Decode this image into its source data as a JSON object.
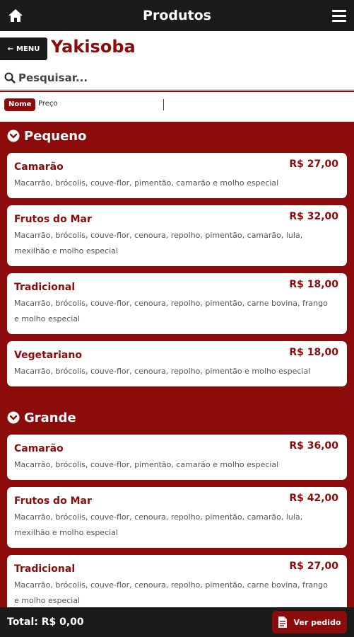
{
  "topbar": {
    "title": "Produtos",
    "home_icon": "home-icon",
    "menu_icon": "hamburger-menu-icon"
  },
  "header": {
    "menu_label": "MENU",
    "title": "Yakisoba"
  },
  "search": {
    "placeholder": "Pesquisar..."
  },
  "filters": {
    "active": "Nome",
    "other": "Preço"
  },
  "sections": [
    {
      "title": "Pequeno",
      "items": [
        {
          "name": "Camarão",
          "price": "R$ 27,00",
          "desc": "Macarrão, brócolis, couve-flor, pimentão, camarão e molho especial"
        },
        {
          "name": "Frutos do Mar",
          "price": "R$ 32,00",
          "desc": "Macarrão, brócolis, couve-flor, cenoura, repolho, pimentão, camarão, lula, mexilhão e molho especial"
        },
        {
          "name": "Tradicional",
          "price": "R$ 18,00",
          "desc": "Macarrão, brócolis, couve-flor, cenoura, repolho, pimentão, carne bovina, frango e molho especial"
        },
        {
          "name": "Vegetariano",
          "price": "R$ 18,00",
          "desc": "Macarrão, brócolis, couve-flor, cenoura, repolho, pimentão e molho especial"
        }
      ]
    },
    {
      "title": "Grande",
      "items": [
        {
          "name": "Camarão",
          "price": "R$ 36,00",
          "desc": "Macarrão, brócolis, couve-flor, pimentão, camarão e molho especial"
        },
        {
          "name": "Frutos do Mar",
          "price": "R$ 42,00",
          "desc": "Macarrão, brócolis, couve-flor, cenoura, repolho, pimentão, camarão, lula, mexilhão e molho especial"
        },
        {
          "name": "Tradicional",
          "price": "R$ 27,00",
          "desc": "Macarrão, brócolis, couve-flor, cenoura, repolho, pimentão, carne bovina, frango e molho especial"
        }
      ]
    }
  ],
  "footer": {
    "total": "Total: R$ 0,00",
    "order_label": "Ver pedido"
  },
  "colors": {
    "brand": "#8c0c0c",
    "dark": "#1b1b1b"
  }
}
